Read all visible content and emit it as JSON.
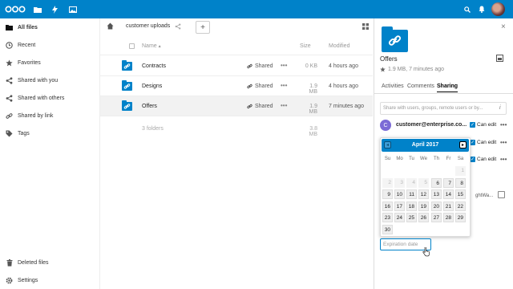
{
  "header": {
    "icons": [
      "nextcloud-logo",
      "files-icon",
      "activity-icon",
      "gallery-icon",
      "search-icon",
      "notifications-icon",
      "user-avatar"
    ]
  },
  "sidebar": {
    "items": [
      {
        "label": "All files",
        "icon": "folder-icon",
        "active": true
      },
      {
        "label": "Recent",
        "icon": "clock-icon"
      },
      {
        "label": "Favorites",
        "icon": "star-icon"
      },
      {
        "label": "Shared with you",
        "icon": "share-icon"
      },
      {
        "label": "Shared with others",
        "icon": "share-icon"
      },
      {
        "label": "Shared by link",
        "icon": "link-icon"
      },
      {
        "label": "Tags",
        "icon": "tag-icon"
      }
    ],
    "bottom": [
      {
        "label": "Deleted files",
        "icon": "trash-icon"
      },
      {
        "label": "Settings",
        "icon": "gear-icon"
      }
    ]
  },
  "breadcrumb": {
    "current": "customer uploads",
    "add_label": "+"
  },
  "table": {
    "columns": {
      "name": "Name",
      "sort_indicator": "▴",
      "size": "Size",
      "modified": "Modified"
    },
    "rows": [
      {
        "name": "Contracts",
        "shared": "Shared",
        "size": "0 KB",
        "modified": "4 hours ago"
      },
      {
        "name": "Designs",
        "shared": "Shared",
        "size": "1.9 MB",
        "modified": "4 hours ago"
      },
      {
        "name": "Offers",
        "shared": "Shared",
        "size": "1.9 MB",
        "modified": "7 minutes ago",
        "selected": true
      }
    ],
    "summary": {
      "count": "3 folders",
      "size": "3.8 MB"
    },
    "more_label": "•••"
  },
  "details": {
    "title": "Offers",
    "meta": "1.9 MB, 7 minutes ago",
    "close_label": "×",
    "tabs": [
      {
        "label": "Activities"
      },
      {
        "label": "Comments"
      },
      {
        "label": "Sharing",
        "active": true
      }
    ],
    "share_placeholder": "Share with users, groups, remote users or by...",
    "info_label": "i",
    "shares": [
      {
        "avatar_letter": "C",
        "name": "customer@enterprise.co...",
        "permission": "Can edit",
        "checked": true
      },
      {
        "permission": "Can edit",
        "checked": true
      },
      {
        "permission": "Can edit",
        "checked": true
      }
    ],
    "partial_text": "ghtWa...",
    "more_label": "•••",
    "check_mark": "✓"
  },
  "datepicker": {
    "month": "April 2017",
    "prev_label": "◂",
    "next_label": "▸",
    "weekdays": [
      "Su",
      "Mo",
      "Tu",
      "We",
      "Th",
      "Fr",
      "Sa"
    ],
    "weeks": [
      [
        null,
        null,
        null,
        null,
        null,
        null,
        "1"
      ],
      [
        "2",
        "3",
        "4",
        "5",
        "6",
        "7",
        "8"
      ],
      [
        "9",
        "10",
        "11",
        "12",
        "13",
        "14",
        "15"
      ],
      [
        "16",
        "17",
        "18",
        "19",
        "20",
        "21",
        "22"
      ],
      [
        "23",
        "24",
        "25",
        "26",
        "27",
        "28",
        "29"
      ],
      [
        "30",
        null,
        null,
        null,
        null,
        null,
        null
      ]
    ],
    "first_enabled": "6",
    "expiration_placeholder": "Expiration date"
  },
  "colors": {
    "brand": "#0082c9",
    "avatar_purple": "#7b6bd6"
  }
}
